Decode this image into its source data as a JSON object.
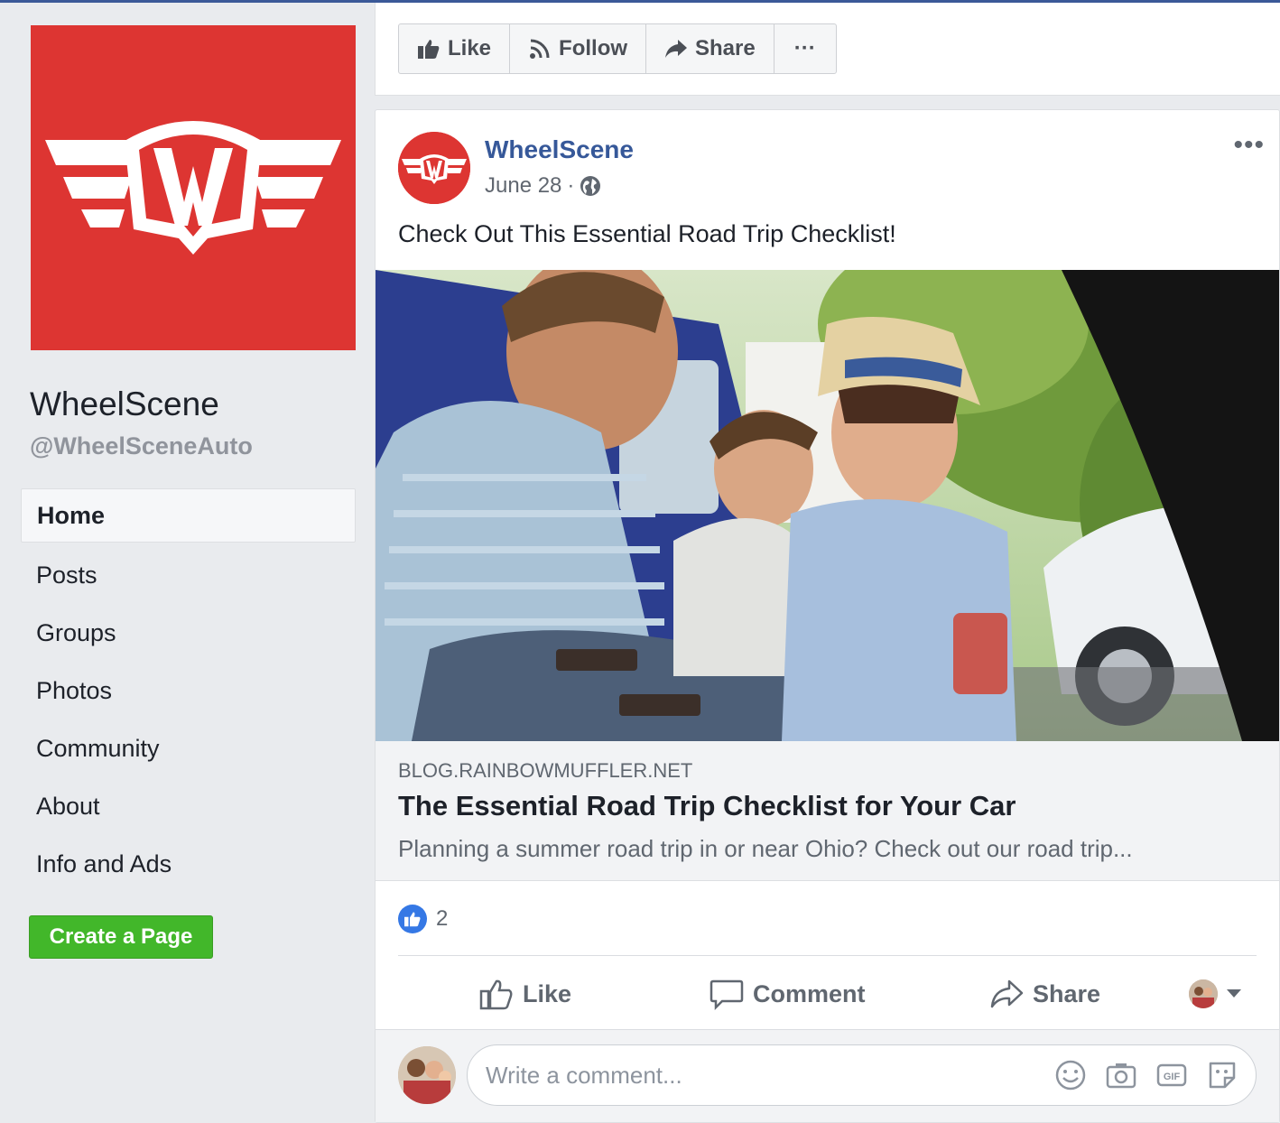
{
  "sidebar": {
    "page_name": "WheelScene",
    "page_handle": "@WheelSceneAuto",
    "nav": [
      "Home",
      "Posts",
      "Groups",
      "Photos",
      "Community",
      "About",
      "Info and Ads"
    ],
    "create_page": "Create a Page"
  },
  "actionbar": {
    "like": "Like",
    "follow": "Follow",
    "share": "Share",
    "more": "···"
  },
  "post": {
    "author": "WheelScene",
    "date": "June 28",
    "date_separator": "·",
    "more": "•••",
    "text": "Check Out This Essential Road Trip Checklist!",
    "link": {
      "domain": "BLOG.RAINBOWMUFFLER.NET",
      "title": "The Essential Road Trip Checklist for Your Car",
      "description": "Planning a summer road trip in or near Ohio? Check out our road trip..."
    },
    "reaction_count": "2",
    "actions": {
      "like": "Like",
      "comment": "Comment",
      "share": "Share"
    },
    "comment_placeholder": "Write a comment..."
  },
  "colors": {
    "brand_red": "#dd3532",
    "link_blue": "#365899",
    "create_green": "#42b72a",
    "like_blue": "#3578e5"
  }
}
